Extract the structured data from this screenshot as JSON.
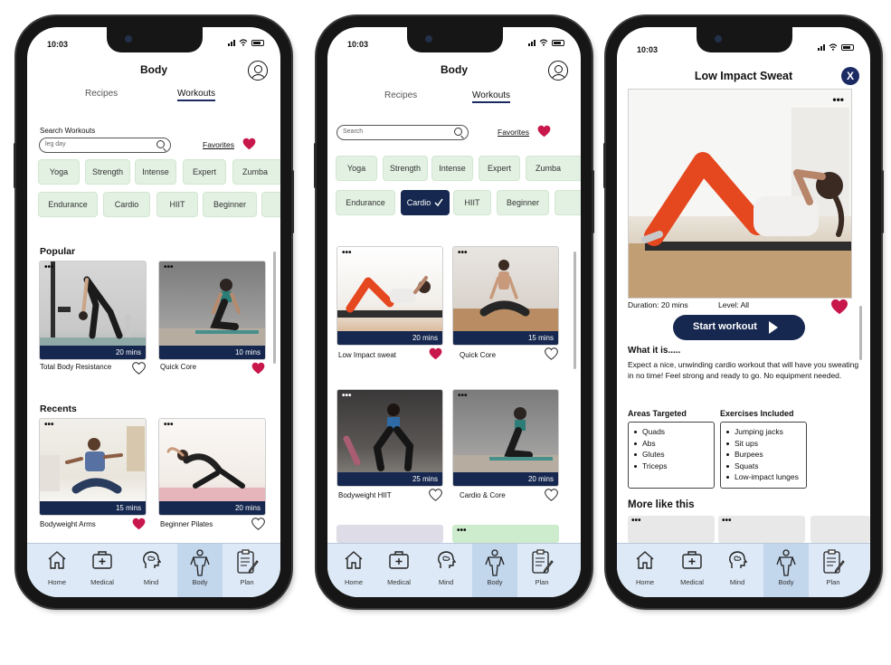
{
  "status": {
    "time": "10:03"
  },
  "nav": [
    "Home",
    "Medical",
    "Mind",
    "Body",
    "Plan"
  ],
  "heart_color": "#c8174a",
  "accent_color": "#16284f",
  "chip_color": "#e2f1e2",
  "screen1": {
    "title": "Body",
    "tabs": [
      "Recipes",
      "Workouts"
    ],
    "search_label": "Search Workouts",
    "search_value": "leg day",
    "favorites": "Favorites",
    "chips_row1": [
      "Yoga",
      "Strength",
      "Intense",
      "Expert",
      "Zumba"
    ],
    "chips_row2": [
      "Endurance",
      "Cardio",
      "HIIT",
      "Beginner"
    ],
    "popular_heading": "Popular",
    "recents_heading": "Recents",
    "popular": [
      {
        "name": "Total Body Resistance",
        "duration": "20 mins",
        "favorite": false
      },
      {
        "name": "Quick Core",
        "duration": "10 mins",
        "favorite": true
      }
    ],
    "recents": [
      {
        "name": "Bodyweight Arms",
        "duration": "15 mins",
        "favorite": true
      },
      {
        "name": "Beginner Pilates",
        "duration": "20 mins",
        "favorite": false
      }
    ]
  },
  "screen2": {
    "title": "Body",
    "tabs": [
      "Recipes",
      "Workouts"
    ],
    "search_placeholder": "Search",
    "favorites": "Favorites",
    "chips_row1": [
      "Yoga",
      "Strength",
      "Intense",
      "Expert",
      "Zumba"
    ],
    "chips_row2": [
      "Endurance",
      "Cardio",
      "HIIT",
      "Beginner"
    ],
    "selected_chip": "Cardio",
    "results": [
      {
        "name": "Low Impact sweat",
        "duration": "20 mins",
        "favorite": true
      },
      {
        "name": "Quick Core",
        "duration": "15 mins",
        "favorite": false
      },
      {
        "name": "Bodyweight HIIT",
        "duration": "25 mins",
        "favorite": false
      },
      {
        "name": "Cardio & Core",
        "duration": "20 mins",
        "favorite": false
      }
    ]
  },
  "screen3": {
    "title": "Low Impact Sweat",
    "close": "X",
    "duration": "Duration: 20 mins",
    "level": "Level: All",
    "start": "Start workout",
    "what_heading": "What it is.....",
    "description": "Expect a nice, unwinding cardio workout that will have you sweating in no time! Feel strong and ready to go. No equipment needed.",
    "areas_heading": "Areas Targeted",
    "areas": [
      "Quads",
      "Abs",
      "Glutes",
      "Triceps"
    ],
    "exercises_heading": "Exercises Included",
    "exercises": [
      "Jumping jacks",
      "Sit ups",
      "Burpees",
      "Squats",
      "Low-impact lunges"
    ],
    "more_heading": "More like this"
  }
}
